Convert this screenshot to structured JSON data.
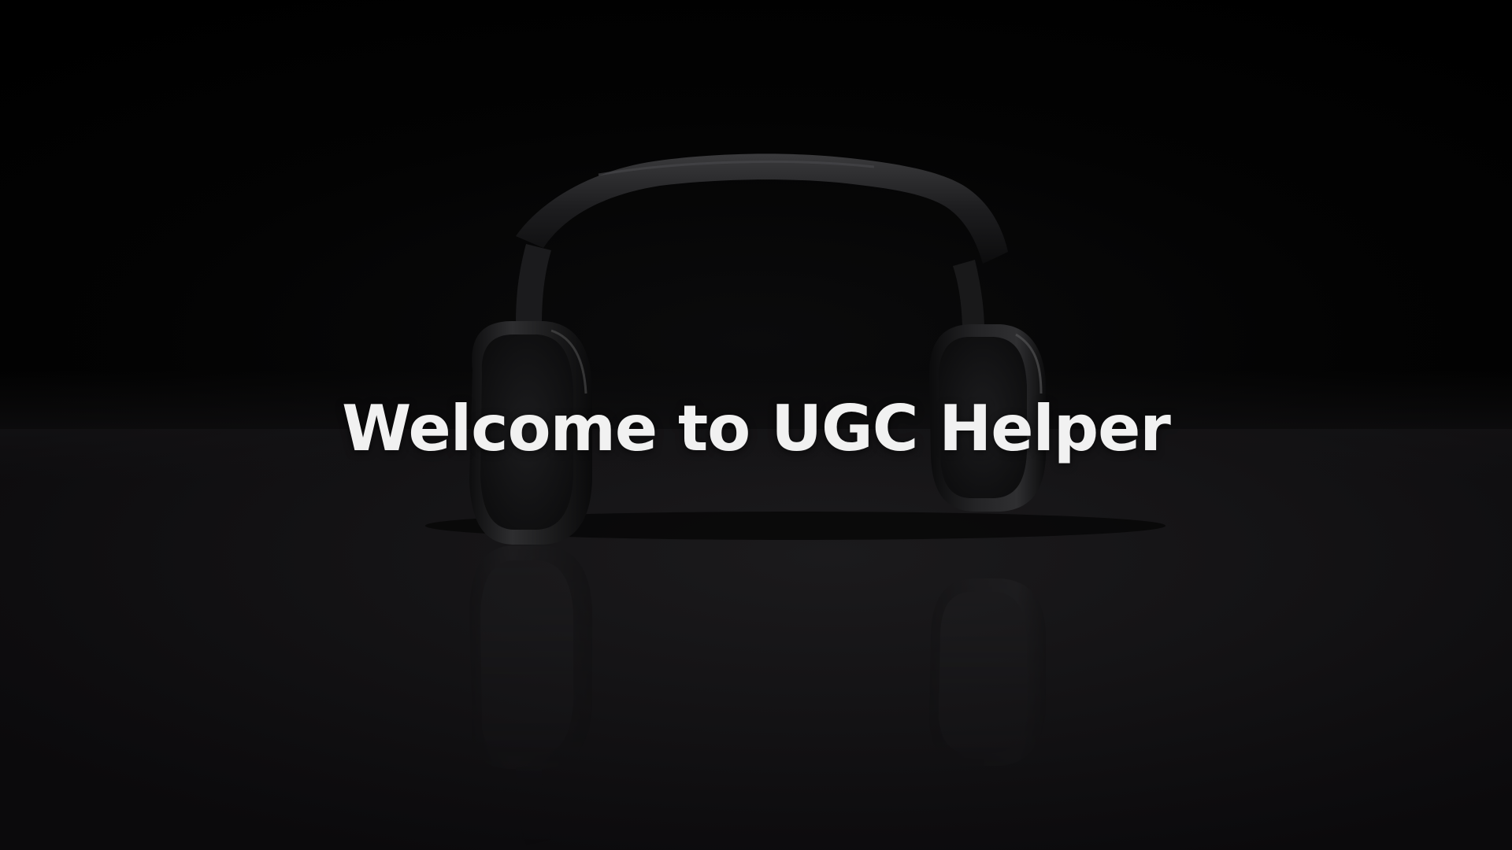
{
  "screen": {
    "title": "Welcome to UGC Helper",
    "illustration": "headphones-icon"
  },
  "colors": {
    "background": "#000000",
    "floor": "#151416",
    "title_text": "#f1f1f1",
    "headphones": "#2a2a2c"
  }
}
